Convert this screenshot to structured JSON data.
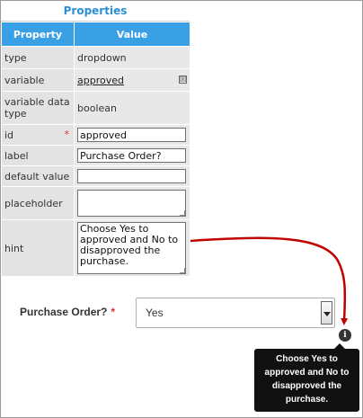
{
  "panel": {
    "title": "Properties",
    "headers": {
      "property": "Property",
      "value": "Value"
    },
    "rows": {
      "type": {
        "label": "type",
        "value": "dropdown"
      },
      "variable": {
        "label": "variable",
        "value": "approved",
        "clear": "☒"
      },
      "variable_data_type": {
        "label": "variable data type",
        "value": "boolean"
      },
      "id": {
        "label": "id",
        "required_mark": "*",
        "value": "approved"
      },
      "label": {
        "label": "label",
        "value": "Purchase Order?"
      },
      "default_value": {
        "label": "default value",
        "value": ""
      },
      "placeholder": {
        "label": "placeholder",
        "value": ""
      },
      "hint": {
        "label": "hint",
        "value": "Choose Yes to approved and No to disapproved the purchase."
      }
    }
  },
  "preview": {
    "label": "Purchase Order?",
    "required_mark": "*",
    "selected": "Yes",
    "info_icon": "i",
    "tooltip": "Choose Yes to approved and No to disapproved the purchase."
  },
  "colors": {
    "header_blue": "#3aa0e6",
    "title_blue": "#2b8fd6",
    "arrow_red": "#c00000",
    "tooltip_bg": "#111111"
  }
}
